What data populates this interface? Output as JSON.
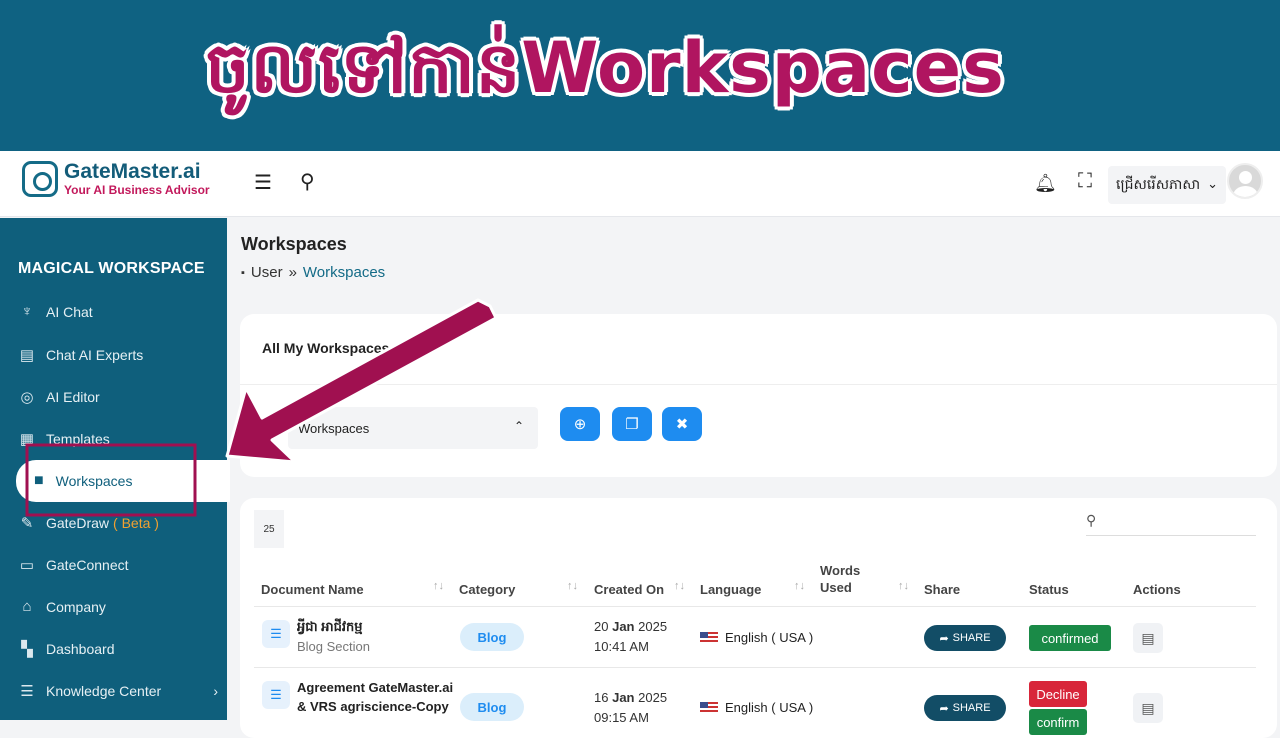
{
  "banner": {
    "title": "ចូលទៅកាន់Workspaces"
  },
  "logo": {
    "name": "GateMaster.ai",
    "tagline": "Your AI Business Advisor"
  },
  "topbar": {
    "language_label": "ជ្រើសរើសភាសា",
    "icons": [
      "menu-icon",
      "search-icon",
      "bell-icon",
      "fullscreen-icon",
      "avatar"
    ]
  },
  "sidebar": {
    "title": "MAGICAL WORKSPACE",
    "items": [
      {
        "label": "AI Chat",
        "icon": "robot-icon"
      },
      {
        "label": "Chat AI Experts",
        "icon": "chat-icon"
      },
      {
        "label": "AI Editor",
        "icon": "editor-icon"
      },
      {
        "label": "Templates",
        "icon": "templates-icon"
      },
      {
        "label": "Workspaces",
        "icon": "folder-icon"
      },
      {
        "label": "GateDraw",
        "badge": "( Beta )",
        "icon": "pencil-icon"
      },
      {
        "label": "GateConnect",
        "icon": "connect-icon"
      },
      {
        "label": "Company",
        "icon": "bank-icon"
      },
      {
        "label": "Dashboard",
        "icon": "dashboard-icon"
      },
      {
        "label": "Knowledge Center",
        "icon": "sliders-icon"
      }
    ]
  },
  "page": {
    "title": "Workspaces",
    "breadcrumb": {
      "root": "User",
      "sep": "»",
      "current": "Workspaces"
    }
  },
  "workspaces_card": {
    "title": "All My Workspaces",
    "select_value": "Workspaces"
  },
  "table": {
    "page_size": "25",
    "columns": {
      "doc": "Document Name",
      "category": "Category",
      "created": "Created On",
      "language": "Language",
      "words_1": "Words",
      "words_2": "Used",
      "share": "Share",
      "status": "Status",
      "actions": "Actions"
    },
    "rows": [
      {
        "title_1": "អ្វីជា អាជីវកម្ម",
        "title_2": "Blog Section",
        "category": "Blog",
        "date_day": "20",
        "date_mon": "Jan",
        "date_year": "2025",
        "time": "10:41 AM",
        "language": "English ( USA )",
        "share": "SHARE",
        "status": "confirmed"
      },
      {
        "title_1": "Agreement GateMaster.ai",
        "title_2": "& VRS agriscience-Copy",
        "category": "Blog",
        "date_day": "16",
        "date_mon": "Jan",
        "date_year": "2025",
        "time": "09:15 AM",
        "language": "English ( USA )",
        "share": "SHARE",
        "status": "Decline",
        "status_2": "confirm"
      }
    ]
  },
  "colors": {
    "banner": "#0f6282",
    "sidebar": "#0f5f7c",
    "accent": "#b01560",
    "primary_button": "#1e8cf0"
  }
}
